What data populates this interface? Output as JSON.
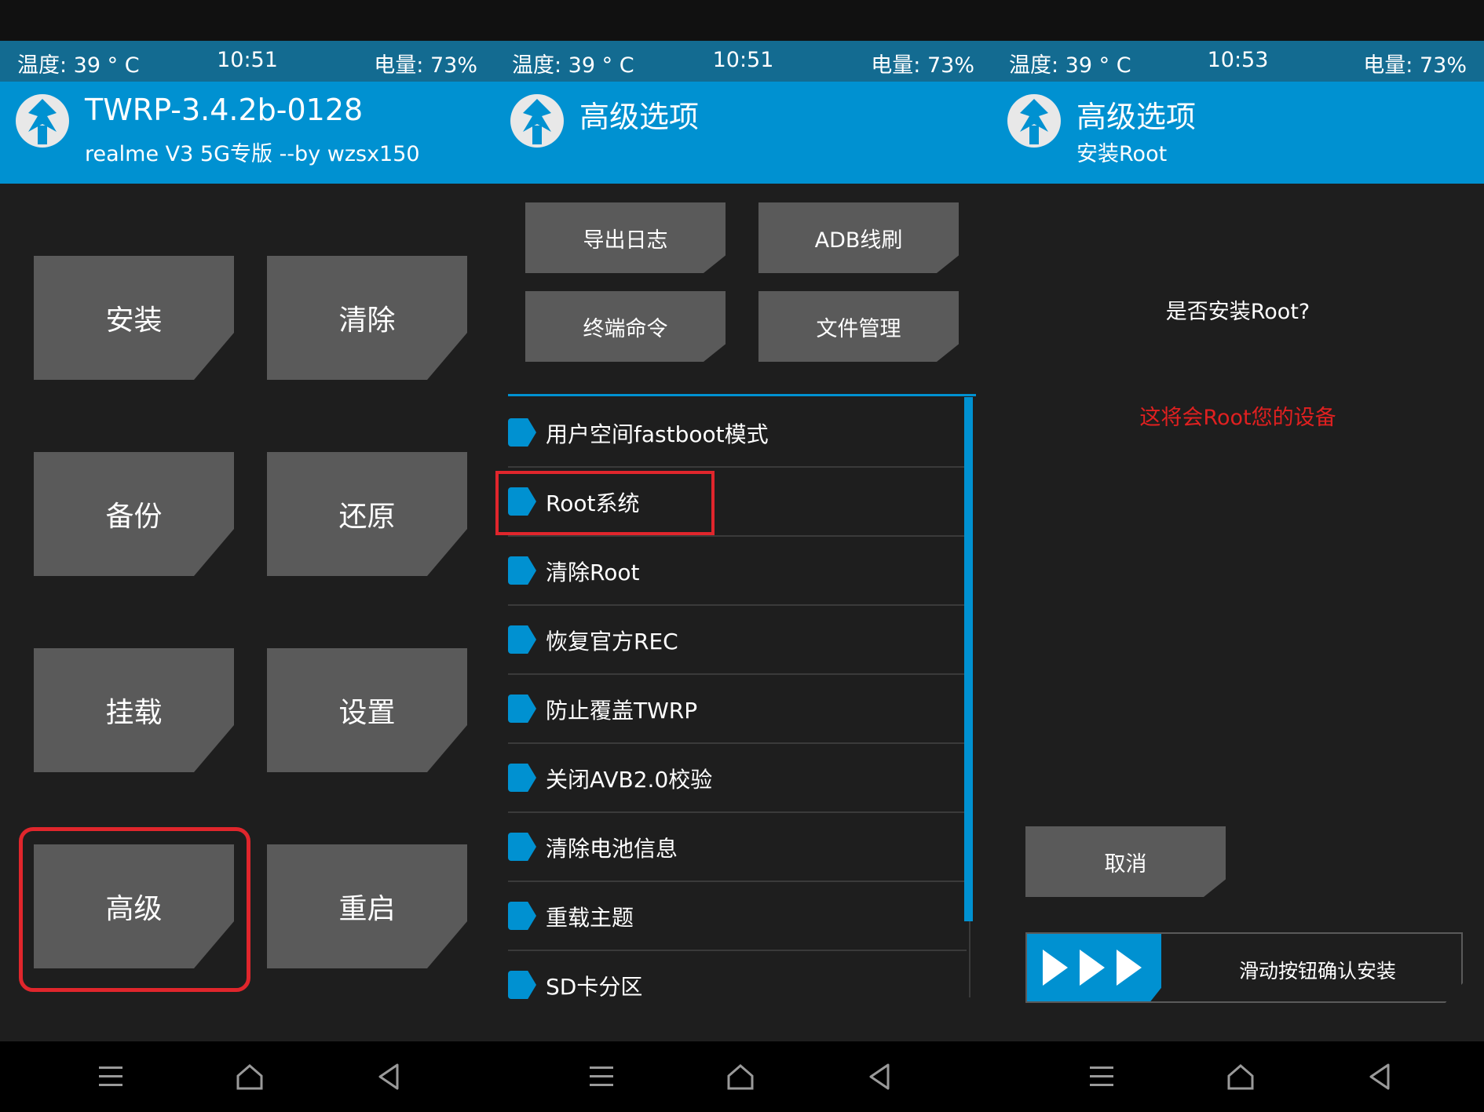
{
  "status_bars": [
    {
      "temp": "温度: 39 ° C",
      "time": "10:51",
      "battery": "电量: 73%"
    },
    {
      "temp": "温度: 39 ° C",
      "time": "10:51",
      "battery": "电量: 73%"
    },
    {
      "temp": "温度: 39 ° C",
      "time": "10:53",
      "battery": "电量: 73%"
    }
  ],
  "screen1": {
    "title": "TWRP-3.4.2b-0128",
    "subtitle": "realme V3 5G专版 --by wzsx150",
    "buttons": [
      "安装",
      "清除",
      "备份",
      "还原",
      "挂载",
      "设置",
      "高级",
      "重启"
    ]
  },
  "screen2": {
    "title": "高级选项",
    "top_buttons": [
      "导出日志",
      "ADB线刷",
      "终端命令",
      "文件管理"
    ],
    "menu_items": [
      "用户空间fastboot模式",
      "Root系统",
      "清除Root",
      "恢复官方REC",
      "防止覆盖TWRP",
      "关闭AVB2.0校验",
      "清除电池信息",
      "重载主题",
      "SD卡分区"
    ]
  },
  "screen3": {
    "title": "高级选项",
    "subtitle": "安装Root",
    "question": "是否安装Root?",
    "warning": "这将会Root您的设备",
    "cancel_label": "取消",
    "slider_label": "滑动按钮确认安装"
  },
  "colors": {
    "accent": "#0091d1",
    "status_bg": "#136b91",
    "highlight": "#e0262c",
    "tile": "#5a5a5a",
    "warning": "#e02020"
  },
  "icons": [
    "twrp-logo-icon",
    "menu-icon",
    "home-icon",
    "back-icon",
    "play-arrow-icon"
  ]
}
